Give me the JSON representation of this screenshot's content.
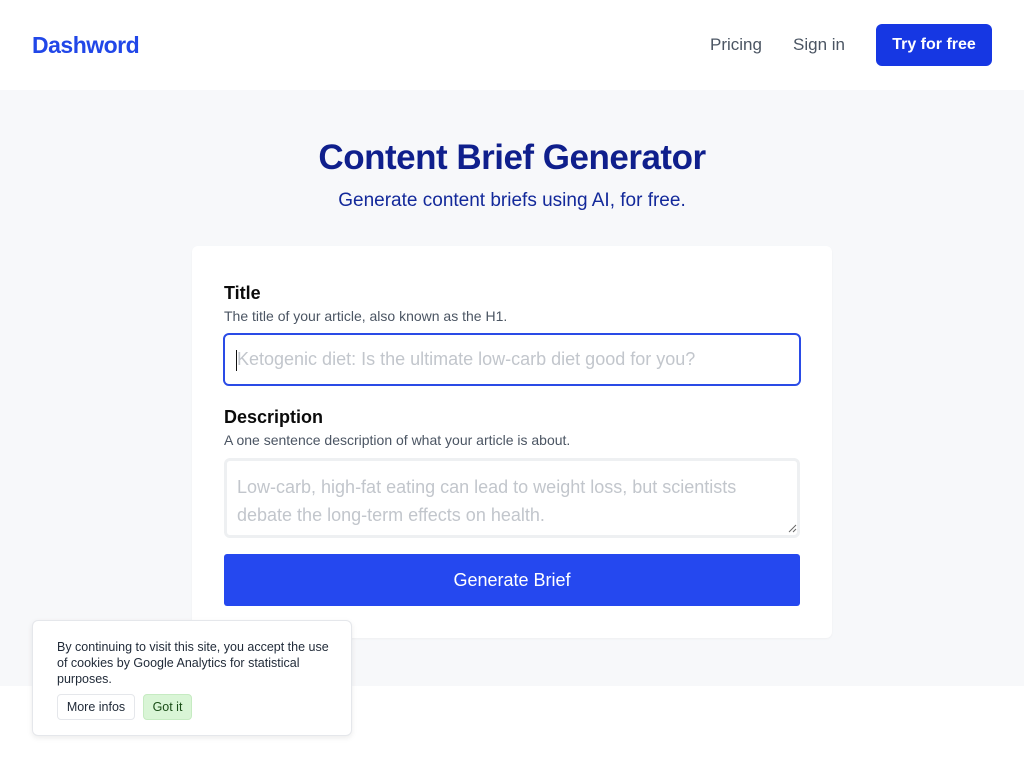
{
  "header": {
    "logo": "Dashword",
    "nav": {
      "pricing": "Pricing",
      "sign_in": "Sign in"
    },
    "cta": "Try for free"
  },
  "hero": {
    "title": "Content Brief Generator",
    "subtitle": "Generate content briefs using AI, for free."
  },
  "form": {
    "title_field": {
      "label": "Title",
      "help": "The title of your article, also known as the H1.",
      "value": "",
      "placeholder": "Ketogenic diet: Is the ultimate low-carb diet good for you?"
    },
    "description_field": {
      "label": "Description",
      "help": "A one sentence description of what your article is about.",
      "value": "",
      "placeholder": "Low-carb, high-fat eating can lead to weight loss, but scientists debate the long-term effects on health."
    },
    "submit_label": "Generate Brief"
  },
  "cookie_banner": {
    "text": "By continuing to visit this site, you accept the use of cookies by Google Analytics for statistical purposes.",
    "more_label": "More infos",
    "accept_label": "Got it"
  },
  "colors": {
    "brand": "#2147e8",
    "cta": "#1637e3",
    "button": "#2548ef",
    "heading": "#0f1f8c",
    "focus_border": "#2a4be6",
    "accept_bg": "#d9f5d6"
  }
}
